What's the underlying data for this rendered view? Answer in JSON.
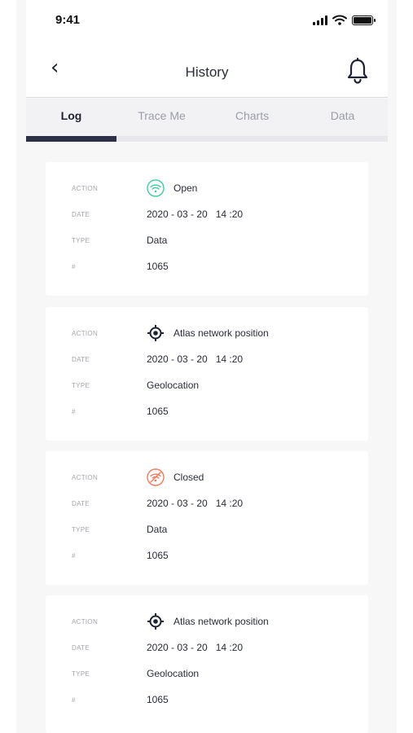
{
  "status_bar": {
    "time": "9:41"
  },
  "header": {
    "title": "History"
  },
  "tabs": [
    {
      "label": "Log",
      "active": true
    },
    {
      "label": "Trace Me",
      "active": false
    },
    {
      "label": "Charts",
      "active": false
    },
    {
      "label": "Data",
      "active": false
    }
  ],
  "field_labels": {
    "action": "ACTION",
    "date": "DATE",
    "type": "TYPE",
    "number": "#"
  },
  "log_entries": [
    {
      "action": "Open",
      "icon": "wifi-open-icon",
      "icon_color": "#3ccf9a",
      "date": "2020 - 03 - 20   14 :20",
      "type": "Data",
      "number": "1065"
    },
    {
      "action": "Atlas network position",
      "icon": "crosshair-location-icon",
      "icon_color": "#1f2230",
      "date": "2020 - 03 - 20   14 :20",
      "type": "Geolocation",
      "number": "1065"
    },
    {
      "action": "Closed",
      "icon": "wifi-closed-icon",
      "icon_color": "#ef7a5e",
      "date": "2020 - 03 - 20   14 :20",
      "type": "Data",
      "number": "1065"
    },
    {
      "action": "Atlas network position",
      "icon": "crosshair-location-icon",
      "icon_color": "#1f2230",
      "date": "2020 - 03 - 20   14 :20",
      "type": "Geolocation",
      "number": "1065"
    }
  ]
}
